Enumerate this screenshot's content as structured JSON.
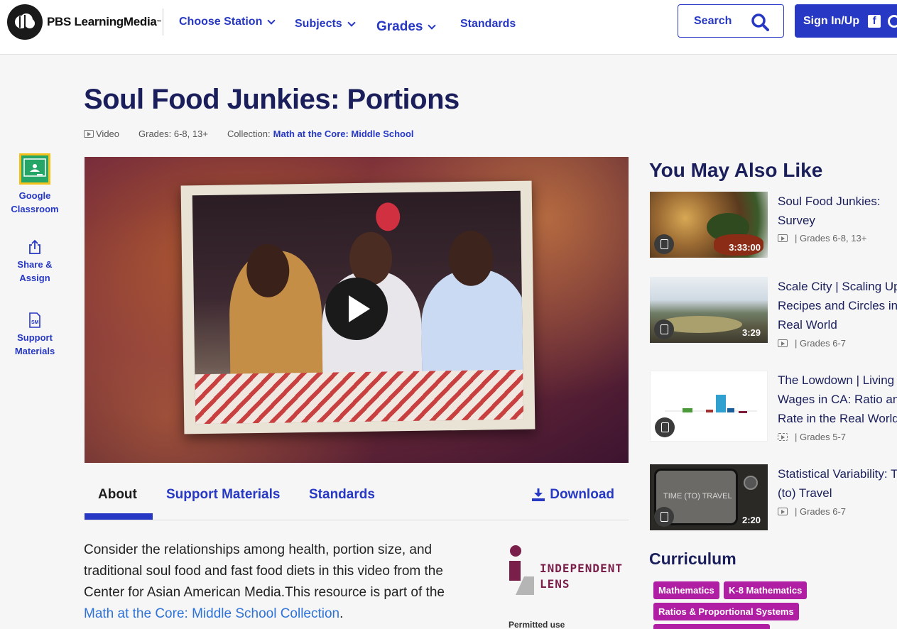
{
  "header": {
    "logo_text": "PBS LearningMedia",
    "logo_tm": "™",
    "nav": [
      {
        "label": "Choose Station"
      },
      {
        "label": "Subjects"
      },
      {
        "label": "Grades"
      },
      {
        "label": "Standards"
      }
    ],
    "search_label": "Search",
    "signin_label": "Sign In/Up",
    "facebook_glyph": "f"
  },
  "resource": {
    "title": "Soul Food Junkies: Portions",
    "type_label": "Video",
    "grades_label": "Grades: 6-8, 13+",
    "collection_prefix": "Collection:",
    "collection_link": "Math at the Core: Middle School"
  },
  "rail": {
    "google_classroom": "Google Classroom",
    "share_assign": "Share & Assign",
    "support_materials": "Support Materials"
  },
  "tabs": {
    "about": "About",
    "support": "Support Materials",
    "standards": "Standards",
    "download": "Download"
  },
  "description": {
    "text": "Consider the relationships among health, portion size, and traditional soul food and fast food diets in this video from the Center for Asian American Media.This resource is part of the ",
    "link": "Math at the Core: Middle School Collection",
    "end": "."
  },
  "partner": {
    "line1": "INDEPENDENT",
    "line2": "LENS",
    "permitted": "Permitted use"
  },
  "sidebar": {
    "heading": "You May Also Like",
    "items": [
      {
        "title": "Soul Food Junkies: Survey",
        "duration": "3:33:00",
        "grades": "| Grades 6-8, 13+"
      },
      {
        "title": "Scale City | Scaling Up Recipes and Circles in the Real World",
        "duration": "3:29",
        "grades": "| Grades 6-7"
      },
      {
        "title": "The Lowdown | Living Wages in CA: Ratio and Rate in the Real World",
        "duration": "",
        "grades": "| Grades 5-7"
      },
      {
        "title": "Statistical Variability: Time (to) Travel",
        "duration": "2:20",
        "grades": "| Grades 6-7",
        "thumb_text": "TIME (TO) TRAVEL"
      }
    ],
    "curriculum_heading": "Curriculum",
    "tags": [
      "Mathematics",
      "K-8 Mathematics",
      "Ratios & Proportional Systems"
    ]
  },
  "colors": {
    "brand_blue": "#2638c4",
    "title_navy": "#1a1f5c",
    "tag_magenta": "#b01fa3",
    "link_blue": "#2f73d9"
  }
}
